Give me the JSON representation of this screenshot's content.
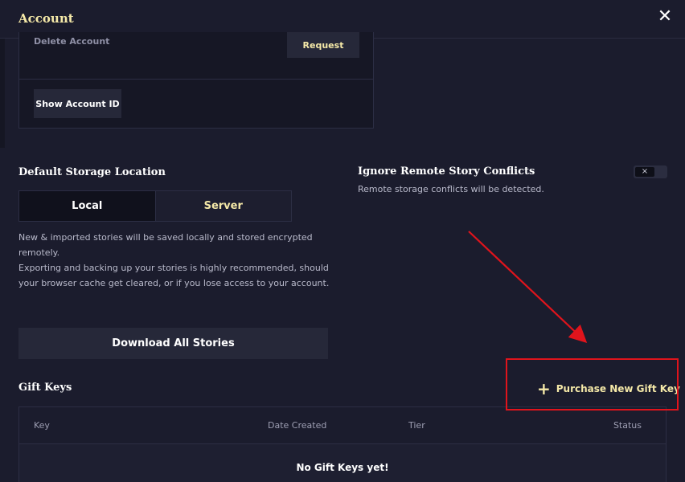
{
  "header": {
    "title": "Account",
    "close_icon": "close-icon"
  },
  "account": {
    "delete_label": "Delete Account",
    "request_label": "Request",
    "show_id_label": "Show Account ID"
  },
  "storage": {
    "title": "Default Storage Location",
    "options": [
      "Local",
      "Server"
    ],
    "selected": "Local",
    "description_1": "New & imported stories will be saved locally and stored encrypted remotely.",
    "description_2": "Exporting and backing up your stories is highly recommended, should your browser cache get cleared, or if you lose access to your account."
  },
  "ignore_conflicts": {
    "title": "Ignore Remote Story Conflicts",
    "description": "Remote storage conflicts will be detected.",
    "toggle_state": "off",
    "toggle_glyph": "×"
  },
  "download_all_label": "Download All Stories",
  "gift_keys": {
    "title": "Gift Keys",
    "purchase_label": "Purchase New Gift Key",
    "columns": [
      "Key",
      "Date Created",
      "Tier",
      "Status"
    ],
    "empty_message": "No Gift Keys yet!"
  },
  "colors": {
    "accent": "#f5e9a8",
    "background": "#1b1c2d",
    "annotation": "#e0141c"
  }
}
